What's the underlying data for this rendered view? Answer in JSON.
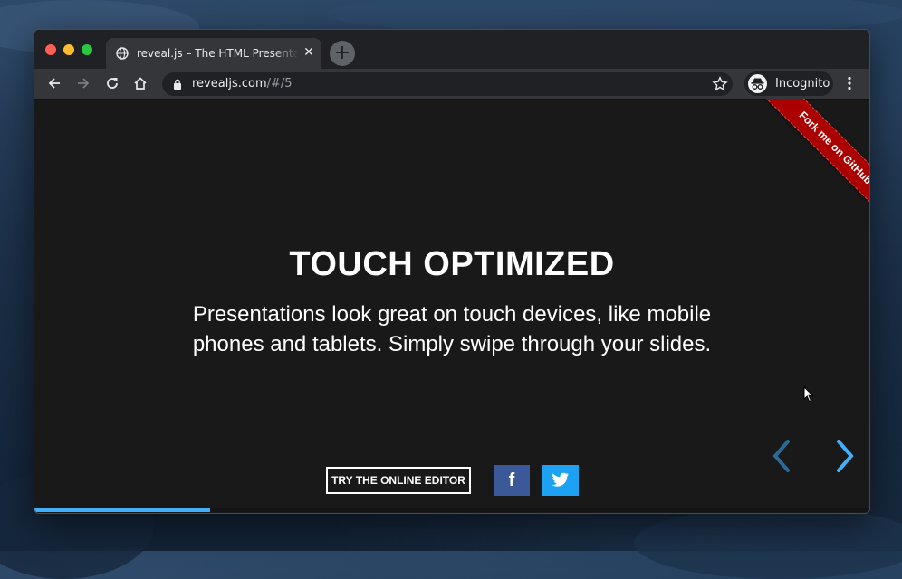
{
  "browser": {
    "tab": {
      "title": "reveal.js – The HTML Presentation Framework",
      "favicon": "globe-icon",
      "close_label": "✕"
    },
    "new_tab_label": "+",
    "toolbar": {
      "back_icon": "arrow-left-icon",
      "forward_icon": "arrow-right-icon",
      "reload_icon": "reload-icon",
      "home_icon": "home-icon",
      "url_domain": "revealjs.com",
      "url_path": "/#/5",
      "bookmark_icon": "star-icon",
      "profile_label": "Incognito",
      "menu_icon": "kebab-menu-icon"
    }
  },
  "slide": {
    "title": "TOUCH OPTIMIZED",
    "text": "Presentations look great on touch devices, like mobile phones and tablets. Simply swipe through your slides.",
    "ribbon": "Fork me on GitHub",
    "editor_button": "TRY THE ONLINE EDITOR",
    "facebook_label": "f",
    "twitter_icon": "twitter-icon",
    "progress_fraction": 0.21
  },
  "colors": {
    "slide_bg": "#191919",
    "accent": "#42affa",
    "ribbon": "#aa0000",
    "facebook": "#3b5998",
    "twitter": "#1da1f2"
  }
}
